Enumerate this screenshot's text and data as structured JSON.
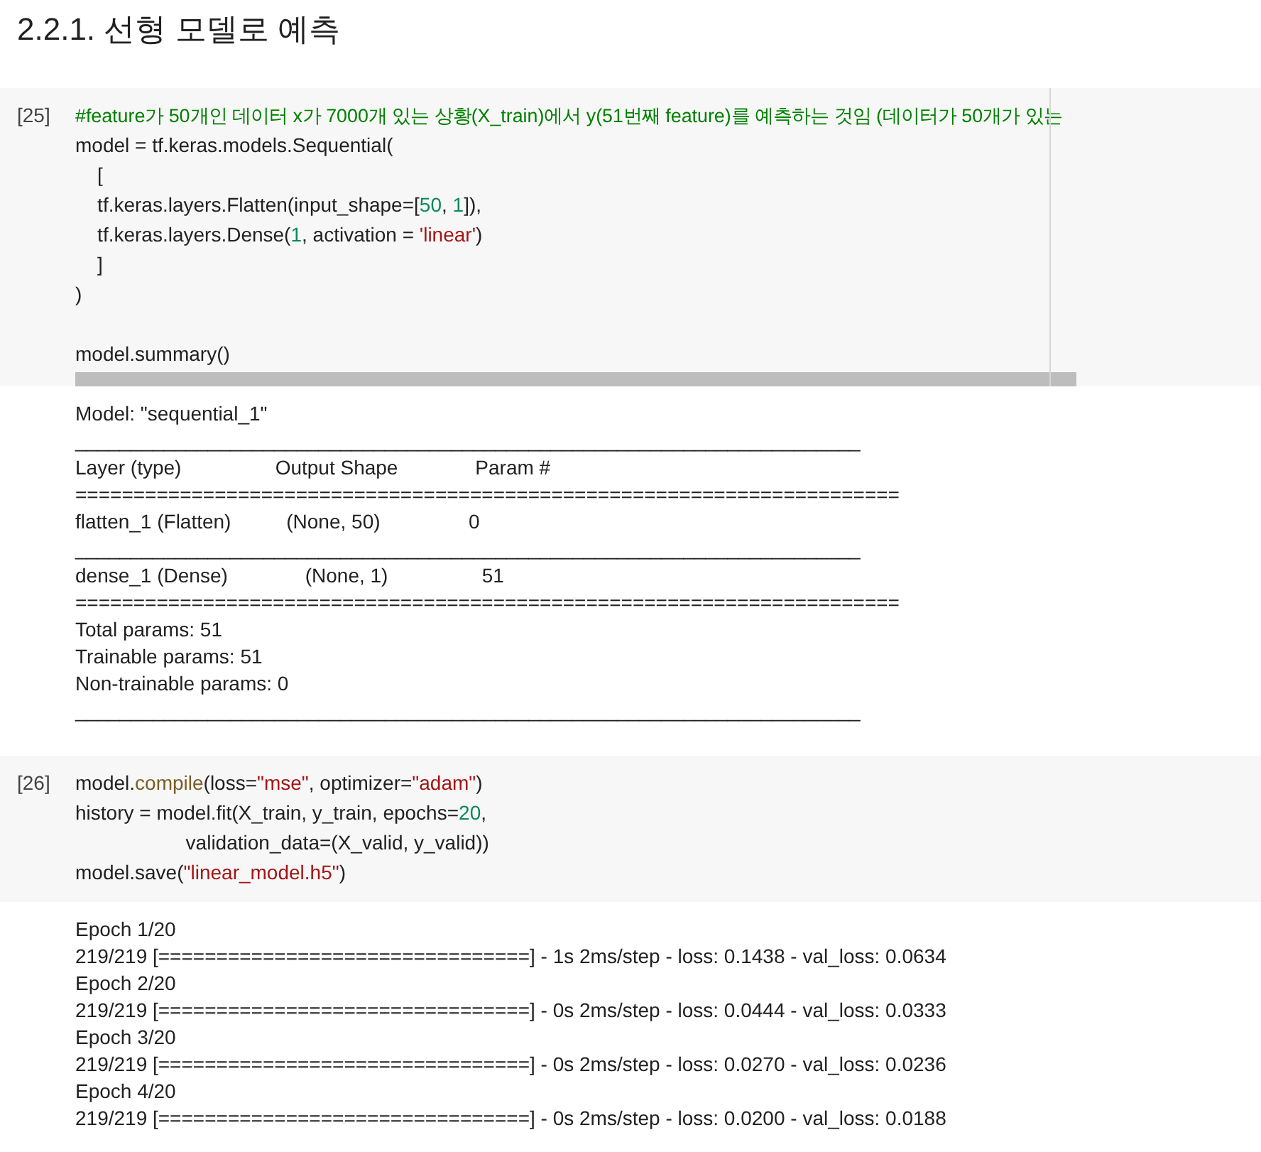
{
  "title": "2.2.1. 선형 모델로 예측",
  "cells": [
    {
      "prompt": "[25]",
      "ruler": true,
      "scrollbar": true,
      "code": [
        {
          "tokens": [
            {
              "text": "#feature가 50개인 데이터 x가 7000개 있는 상황(X_train)에서 y(51번째 feature)를 예측하는 것임 (데이터가 50개가 있는",
              "kind": "comment"
            }
          ]
        },
        {
          "tokens": [
            {
              "text": "model = tf.keras.models.Sequential(",
              "kind": "plain"
            }
          ]
        },
        {
          "tokens": [
            {
              "text": "    [",
              "kind": "plain"
            }
          ]
        },
        {
          "tokens": [
            {
              "text": "    tf.keras.layers.Flatten(input_shape=[",
              "kind": "plain"
            },
            {
              "text": "50",
              "kind": "number"
            },
            {
              "text": ", ",
              "kind": "plain"
            },
            {
              "text": "1",
              "kind": "number"
            },
            {
              "text": "]),",
              "kind": "plain"
            }
          ]
        },
        {
          "tokens": [
            {
              "text": "    tf.keras.layers.Dense(",
              "kind": "plain"
            },
            {
              "text": "1",
              "kind": "number"
            },
            {
              "text": ", activation = ",
              "kind": "plain"
            },
            {
              "text": "'linear'",
              "kind": "string"
            },
            {
              "text": ")",
              "kind": "plain"
            }
          ]
        },
        {
          "tokens": [
            {
              "text": "    ]",
              "kind": "plain"
            }
          ]
        },
        {
          "tokens": [
            {
              "text": ")",
              "kind": "plain"
            }
          ]
        },
        {
          "blank_before": true,
          "tokens": [
            {
              "text": "model.summary()",
              "kind": "plain"
            }
          ]
        }
      ],
      "output": [
        "Model: \"sequential_1\"",
        "_______________________________________________________________________",
        "Layer (type)                 Output Shape              Param #   ",
        "=======================================================================",
        "flatten_1 (Flatten)          (None, 50)                0         ",
        "_______________________________________________________________________",
        "dense_1 (Dense)              (None, 1)                 51        ",
        "=======================================================================",
        "Total params: 51",
        "Trainable params: 51",
        "Non-trainable params: 0",
        "_______________________________________________________________________"
      ]
    },
    {
      "prompt": "[26]",
      "ruler": false,
      "scrollbar": false,
      "code": [
        {
          "tokens": [
            {
              "text": "model.",
              "kind": "plain"
            },
            {
              "text": "compile",
              "kind": "function"
            },
            {
              "text": "(loss=",
              "kind": "plain"
            },
            {
              "text": "\"mse\"",
              "kind": "string"
            },
            {
              "text": ", optimizer=",
              "kind": "plain"
            },
            {
              "text": "\"adam\"",
              "kind": "string"
            },
            {
              "text": ")",
              "kind": "plain"
            }
          ]
        },
        {
          "tokens": [
            {
              "text": "history = model.fit(X_train, y_train, epochs=",
              "kind": "plain"
            },
            {
              "text": "20",
              "kind": "number"
            },
            {
              "text": ",",
              "kind": "plain"
            }
          ]
        },
        {
          "tokens": [
            {
              "text": "                    validation_data=(X_valid, y_valid))",
              "kind": "plain"
            }
          ]
        },
        {
          "tokens": [
            {
              "text": "model.save(",
              "kind": "plain"
            },
            {
              "text": "\"linear_model.h5\"",
              "kind": "string"
            },
            {
              "text": ")",
              "kind": "plain"
            }
          ]
        }
      ],
      "output": [
        "Epoch 1/20",
        "219/219 [================================] - 1s 2ms/step - loss: 0.1438 - val_loss: 0.0634",
        "Epoch 2/20",
        "219/219 [================================] - 0s 2ms/step - loss: 0.0444 - val_loss: 0.0333",
        "Epoch 3/20",
        "219/219 [================================] - 0s 2ms/step - loss: 0.0270 - val_loss: 0.0236",
        "Epoch 4/20",
        "219/219 [================================] - 0s 2ms/step - loss: 0.0200 - val_loss: 0.0188"
      ]
    }
  ]
}
